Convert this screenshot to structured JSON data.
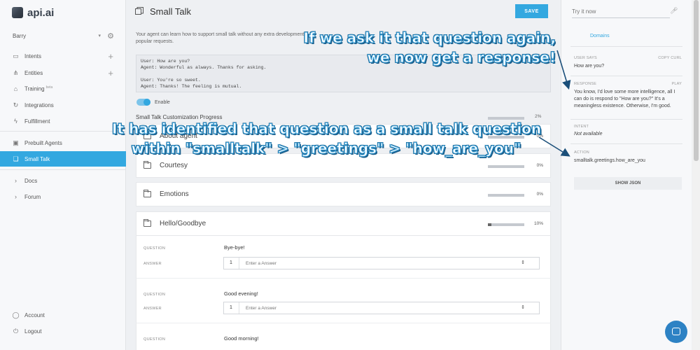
{
  "sidebar": {
    "logo": "api.ai",
    "agent": "Barry",
    "items": [
      {
        "label": "Intents",
        "icon": "chat-bubble-icon"
      },
      {
        "label": "Entities",
        "icon": "sitemap-icon"
      },
      {
        "label": "Training",
        "badge": "beta",
        "icon": "graduation-cap-icon"
      },
      {
        "label": "Integrations",
        "icon": "refresh-icon"
      },
      {
        "label": "Fulfillment",
        "icon": "bolt-icon"
      },
      {
        "label": "Prebuilt Agents",
        "icon": "inbox-icon"
      },
      {
        "label": "Small Talk",
        "icon": "chat-icon",
        "active": true
      },
      {
        "label": "Docs",
        "icon": "chevron-right-icon"
      },
      {
        "label": "Forum",
        "icon": "chevron-right-icon"
      },
      {
        "label": "Account",
        "icon": "user-icon"
      },
      {
        "label": "Logout",
        "icon": "power-icon"
      }
    ]
  },
  "header": {
    "title": "Small Talk",
    "save_label": "SAVE"
  },
  "main": {
    "description": "Your agent can learn how to support small talk without any extra development. popular requests.",
    "example_lines": [
      "User: How are you?",
      "Agent: Wonderful as always. Thanks for asking.",
      "",
      "User: You're so sweet.",
      "Agent: Thanks! The feeling is mutual."
    ],
    "toggle_label": "Enable",
    "toggle_on": true,
    "progress_label": "Small Talk Customization Progress",
    "progress_pct": "2%",
    "categories": [
      {
        "name": "About agent",
        "pct": "0%",
        "fill": 0
      },
      {
        "name": "Courtesy",
        "pct": "0%",
        "fill": 0
      },
      {
        "name": "Emotions",
        "pct": "0%",
        "fill": 0
      },
      {
        "name": "Hello/Goodbye",
        "pct": "10%",
        "fill": 0.1
      }
    ],
    "question_label": "QUESTION",
    "answer_label": "ANSWER",
    "answer_placeholder": "Enter a Answer",
    "questions": [
      {
        "text": "Bye-bye!",
        "n": "1"
      },
      {
        "text": "Good evening!",
        "n": "1"
      },
      {
        "text": "Good morning!"
      }
    ]
  },
  "right_panel": {
    "try_placeholder": "Try it now",
    "tab": "Domains",
    "user_says_label": "USER SAYS",
    "copy_curl": "COPY CURL",
    "user_says": "How are you?",
    "response_label": "RESPONSE",
    "play_label": "PLAY",
    "response": "You know, I'd love some more intelligence, all I can do is respond to \"How are you?\" It's a meaningless existence. Otherwise, I'm good.",
    "intent_label": "INTENT",
    "intent": "Not available",
    "action_label": "ACTION",
    "action": "smalltalk.greetings.how_are_you",
    "show_json": "SHOW JSON"
  },
  "annotations": {
    "top_line1": "If we ask it that question again,",
    "top_line2": "we now get a response!",
    "mid_line1": "It has identified that question as a small talk question",
    "mid_line2": "within \"smalltalk\" > \"greetings\" > \"how_are_you\""
  }
}
